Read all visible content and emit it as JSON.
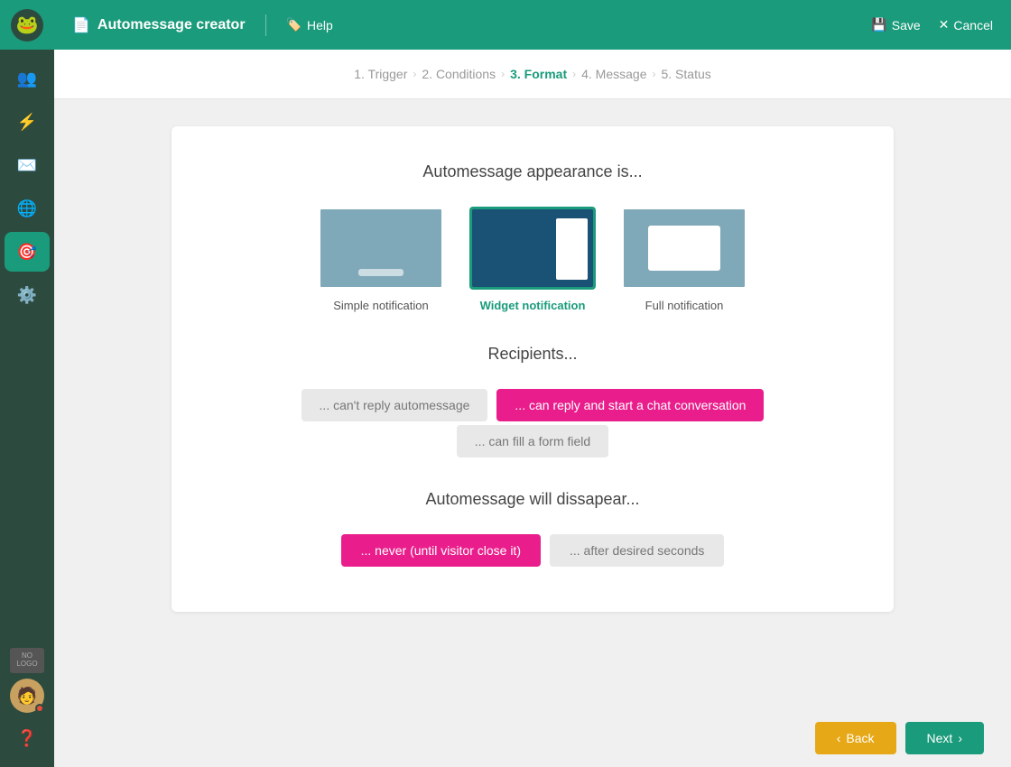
{
  "topbar": {
    "title": "Automessage creator",
    "help_label": "Help",
    "save_label": "Save",
    "cancel_label": "Cancel"
  },
  "breadcrumb": {
    "steps": [
      {
        "id": "trigger",
        "label": "1. Trigger",
        "active": false
      },
      {
        "id": "conditions",
        "label": "2. Conditions",
        "active": false
      },
      {
        "id": "format",
        "label": "3. Format",
        "active": true
      },
      {
        "id": "message",
        "label": "4. Message",
        "active": false
      },
      {
        "id": "status",
        "label": "5. Status",
        "active": false
      }
    ]
  },
  "card": {
    "appearance_title": "Automessage appearance is...",
    "notification_types": [
      {
        "id": "simple",
        "label": "Simple notification",
        "selected": false
      },
      {
        "id": "widget",
        "label": "Widget notification",
        "selected": true
      },
      {
        "id": "full",
        "label": "Full notification",
        "selected": false
      }
    ],
    "recipients_title": "Recipients...",
    "recipient_buttons": [
      {
        "id": "cant-reply",
        "label": "... can't reply automessage",
        "active": false
      },
      {
        "id": "can-reply",
        "label": "... can reply and start a chat conversation",
        "active": true
      },
      {
        "id": "form-field",
        "label": "... can fill a form field",
        "active": false
      }
    ],
    "disappear_title": "Automessage will dissapear...",
    "disappear_buttons": [
      {
        "id": "never",
        "label": "... never (until visitor close it)",
        "active": true
      },
      {
        "id": "after-seconds",
        "label": "... after desired seconds",
        "active": false
      }
    ]
  },
  "actions": {
    "back_label": "Back",
    "next_label": "Next"
  },
  "sidebar": {
    "items": [
      {
        "id": "team",
        "icon": "👥"
      },
      {
        "id": "flash",
        "icon": "⚡"
      },
      {
        "id": "inbox",
        "icon": "✉️"
      },
      {
        "id": "globe",
        "icon": "🌐"
      },
      {
        "id": "target",
        "icon": "🎯",
        "active": true
      },
      {
        "id": "settings",
        "icon": "⚙️"
      }
    ]
  }
}
